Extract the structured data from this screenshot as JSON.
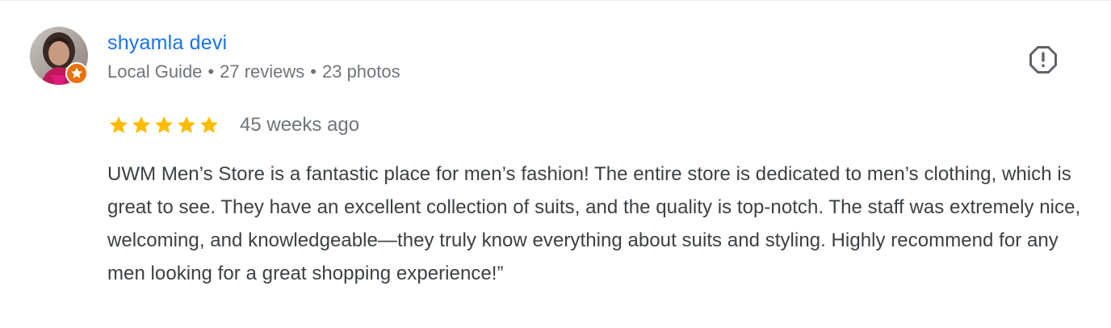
{
  "reviewer": {
    "name": "shyamla devi",
    "badge": "Local Guide",
    "reviews": "27 reviews",
    "photos": "23 photos",
    "separator": "•"
  },
  "review": {
    "rating": 5,
    "rating_max": 5,
    "date": "45 weeks ago",
    "text": "UWM Men’s Store is a fantastic place for men’s fashion! The entire store is dedicated to men’s clothing, which is great to see. They have an excellent collection of suits, and the quality is top-notch. The staff was extremely nice, welcoming, and knowledgeable—they truly know everything about suits and styling. Highly recommend for any men looking for a great shopping experience!”"
  },
  "icons": {
    "report": "report-flag-icon",
    "star": "star-icon",
    "local_guide": "local-guide-star-icon"
  },
  "colors": {
    "name_link": "#1a73e8",
    "star": "#fbbc04",
    "meta_text": "#70757a",
    "body_text": "#3c4043",
    "guide_badge": "#e8710a"
  }
}
